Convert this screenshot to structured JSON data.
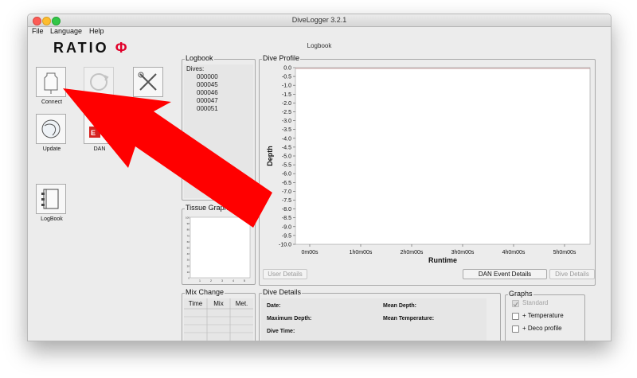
{
  "window": {
    "title": "DiveLogger 3.2.1"
  },
  "menu": [
    "File",
    "Language",
    "Help"
  ],
  "header": {
    "title": "Logbook"
  },
  "brand": {
    "text": "RATIO",
    "symbol": "Φ",
    "symbol_color": "#e1002a"
  },
  "toolbar": {
    "connect": "Connect",
    "setup": "Setup",
    "update": "Update",
    "dan": "DAN",
    "logbook": "LogBook"
  },
  "logbook_panel": {
    "title": "Logbook",
    "dives_label": "Dives:",
    "dives": [
      "000000",
      "000045",
      "000046",
      "000047",
      "000051"
    ]
  },
  "tissue_panel": {
    "title": "Tissue Graph"
  },
  "mix_panel": {
    "title": "Mix Change",
    "columns": [
      "Time",
      "Mix",
      "Met."
    ]
  },
  "dive_profile": {
    "title": "Dive Profile",
    "user_details_button": "User Details",
    "dan_event_button": "DAN Event Details",
    "dive_details_button": "Dive Details"
  },
  "chart_data": {
    "type": "line",
    "title": "",
    "xlabel": "Runtime",
    "ylabel": "Depth",
    "x_ticks": [
      "0m00s",
      "1h0m00s",
      "2h0m00s",
      "3h0m00s",
      "4h0m00s",
      "5h0m00s"
    ],
    "y_ticks": [
      "0.0",
      "-0.5",
      "-1.0",
      "-1.5",
      "-2.0",
      "-2.5",
      "-3.0",
      "-3.5",
      "-4.0",
      "-4.5",
      "-5.0",
      "-5.5",
      "-6.0",
      "-6.5",
      "-7.0",
      "-7.5",
      "-8.0",
      "-8.5",
      "-9.0",
      "-9.5",
      "-10.0"
    ],
    "ylim": [
      -10.0,
      0.0
    ],
    "series": [],
    "grid": false
  },
  "tissue_chart": {
    "y_ticks": [
      "100",
      "90",
      "80",
      "70",
      "60",
      "50",
      "40",
      "30",
      "20",
      "10",
      "0"
    ],
    "x_ticks": [
      "1",
      "2",
      "3",
      "4",
      "5"
    ]
  },
  "dive_details": {
    "title": "Dive Details",
    "date": "Date:",
    "max_depth": "Maximum Depth:",
    "dive_time": "Dive Time:",
    "mean_depth": "Mean Depth:",
    "mean_temp": "Mean Temperature:"
  },
  "graphs": {
    "title": "Graphs",
    "standard": "Standard",
    "temperature": "+ Temperature",
    "deco": "+ Deco profile"
  },
  "annotation": {
    "arrow_color": "#ff0000"
  }
}
